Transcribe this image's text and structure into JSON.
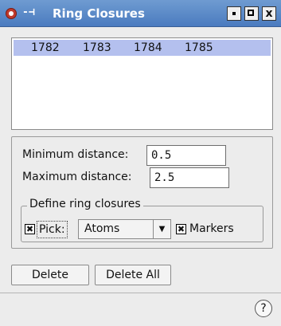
{
  "window": {
    "title": "Ring Closures",
    "icons": [
      "app-icon",
      "pin-icon"
    ],
    "controls": {
      "minimize_icon": "minimize-icon",
      "maximize_icon": "maximize-icon",
      "close_glyph": "x"
    }
  },
  "list": {
    "selected_row": [
      "1782",
      "1783",
      "1784",
      "1785"
    ]
  },
  "distance": {
    "min_label": "Minimum distance:",
    "min_value": "0.5",
    "max_label": "Maximum distance:",
    "max_value": "2.5"
  },
  "ring": {
    "group_title": "Define ring closures",
    "pick_label": "Pick:",
    "pick_checked": true,
    "mode_selected": "Atoms",
    "markers_label": "Markers",
    "markers_checked": true
  },
  "buttons": {
    "delete": "Delete",
    "delete_all": "Delete All"
  },
  "help": {
    "glyph": "?"
  }
}
